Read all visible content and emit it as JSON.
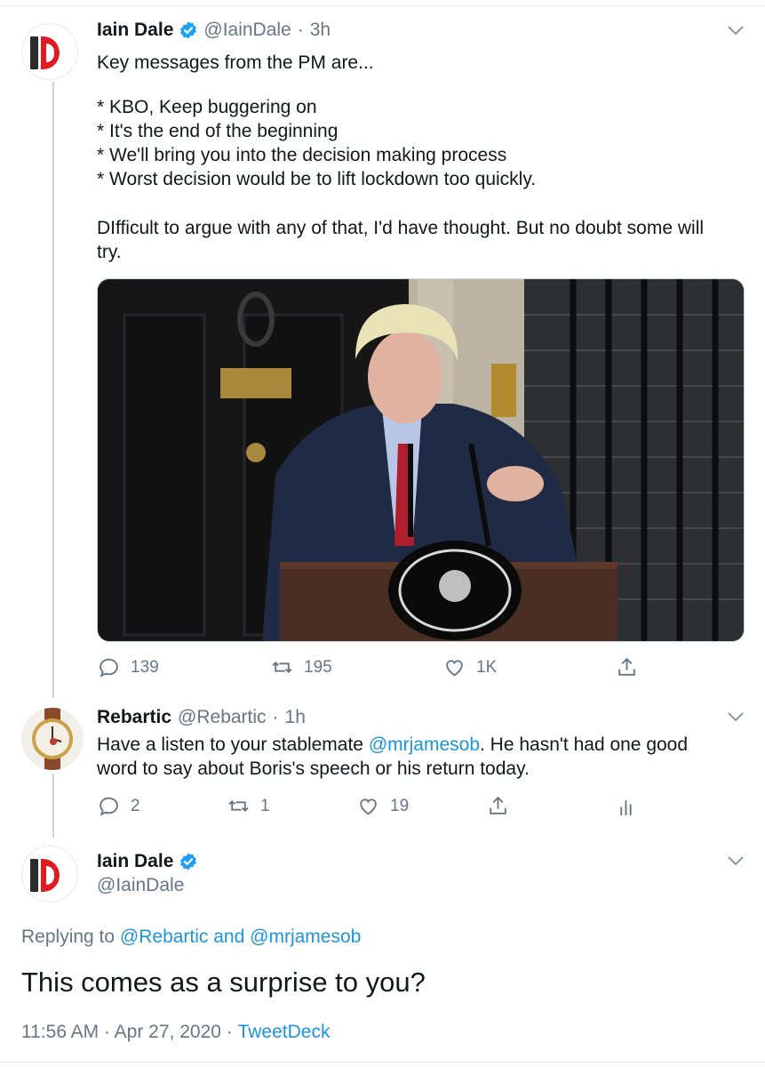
{
  "tweet1": {
    "name": "Iain Dale",
    "handle": "@IainDale",
    "separator": "·",
    "time": "3h",
    "lines": [
      "Key messages from the PM are...",
      "* KBO, Keep buggering on",
      "* It's the end of the beginning",
      "* We'll bring you into the decision making process",
      "* Worst decision would be to lift lockdown too quickly.",
      "DIfficult to argue with any of that, I'd have thought. But no doubt some will",
      "try."
    ],
    "reply_count": "139",
    "retweet_count": "195",
    "like_count": "1K"
  },
  "tweet2": {
    "name": "Rebartic",
    "handle": "@Rebartic",
    "separator": "·",
    "time": "1h",
    "line1_before": "Have a listen to your stablemate ",
    "line1_mention": "@mrjamesob",
    "line1_after": ". He hasn't had one good",
    "line2": "word to say about Boris's speech or his return today.",
    "reply_count": "2",
    "retweet_count": "1",
    "like_count": "19"
  },
  "tweet3": {
    "name": "Iain Dale",
    "handle": "@IainDale",
    "replying_prefix": "Replying to ",
    "replying_user1": "@Rebartic",
    "replying_and": " and ",
    "replying_user2": "@mrjamesob",
    "text": "This comes as a surprise to you?",
    "timestamp": "11:56 AM · Apr 27, 2020 · ",
    "source": "TweetDeck"
  },
  "colors": {
    "link": "#1b95e0",
    "text": "#14171a",
    "secondary": "#657786",
    "divider": "#e6ecf0",
    "brand_red": "#e11b22"
  },
  "icons": [
    "verified-icon",
    "chevron-down-icon",
    "reply-icon",
    "retweet-icon",
    "like-icon",
    "share-icon",
    "analytics-icon"
  ]
}
